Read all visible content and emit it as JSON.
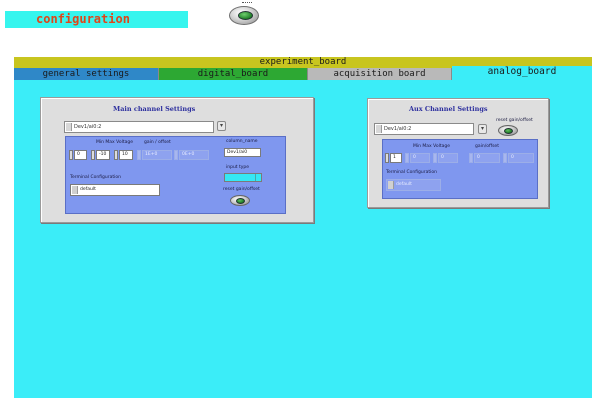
{
  "header": {
    "config_title": "configuration",
    "run_button_icon": "toggle-button-icon"
  },
  "board": {
    "title": "experiment_board",
    "tabs": [
      {
        "label": "general settings",
        "color": "#2f88c8"
      },
      {
        "label": "digital_board",
        "color": "#2da833"
      },
      {
        "label": "acquisition board",
        "color": "#b9b9b9"
      },
      {
        "label": "analog_board",
        "color": "#3bedf8",
        "selected": true
      }
    ]
  },
  "main_channel": {
    "title": "Main channel Settings",
    "device": "Dev1/ai0:2",
    "index_value": "0",
    "label_minmax": "Min  Max Voltage",
    "label_gainoffset": "gain / offset",
    "min_voltage": "-10",
    "max_voltage": "10",
    "gain": "1E+0",
    "offset": "0E+0",
    "column_name_label": "column_name",
    "column_name_value": "Dev1/ai0",
    "input_type_label": "input type",
    "terminal_config_label": "Terminal Configuration",
    "terminal_config_value": "default",
    "reset_label": "reset gain/offset"
  },
  "aux_channel": {
    "title": "Aux Channel Settings",
    "device": "Dev1/ai0:2",
    "reset_label": "reset gain/offset",
    "index_value": "1",
    "label_minmax": "Min Max Voltage",
    "label_gainoffset": "gain/offset",
    "min_voltage": "0",
    "max_voltage": "0",
    "gain": "0",
    "offset": "0",
    "terminal_config_label": "Terminal Configuration",
    "terminal_config_value": "default"
  },
  "colors": {
    "panel_background": "#3bedf8",
    "title_bar": "#c8c51f",
    "config_text": "#e0451a"
  }
}
